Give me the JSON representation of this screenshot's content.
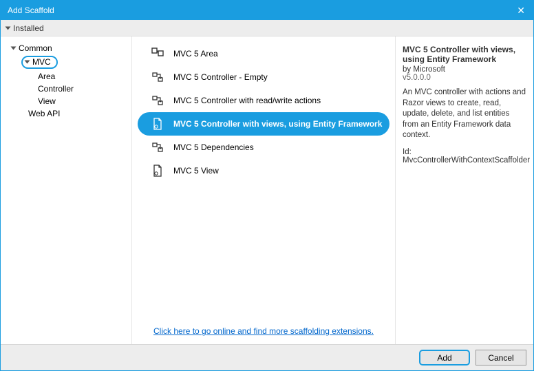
{
  "window": {
    "title": "Add Scaffold"
  },
  "installed_tab": "Installed",
  "tree": {
    "common": "Common",
    "mvc": "MVC",
    "area": "Area",
    "controller": "Controller",
    "view": "View",
    "webapi": "Web API"
  },
  "templates": [
    {
      "label": "MVC 5 Area",
      "icon": "area"
    },
    {
      "label": "MVC 5 Controller - Empty",
      "icon": "controller"
    },
    {
      "label": "MVC 5 Controller with read/write actions",
      "icon": "controller"
    },
    {
      "label": "MVC 5 Controller with views, using Entity Framework",
      "icon": "page",
      "selected": true
    },
    {
      "label": "MVC 5 Dependencies",
      "icon": "controller"
    },
    {
      "label": "MVC 5 View",
      "icon": "page"
    }
  ],
  "link_text": "Click here to go online and find more scaffolding extensions.",
  "details": {
    "title": "MVC 5 Controller with views, using Entity Framework",
    "by": "by Microsoft",
    "version": "v5.0.0.0",
    "description": "An MVC controller with actions and Razor views to create, read, update, delete, and list entities from an Entity Framework data context.",
    "id": "Id: MvcControllerWithContextScaffolder"
  },
  "buttons": {
    "add": "Add",
    "cancel": "Cancel"
  }
}
